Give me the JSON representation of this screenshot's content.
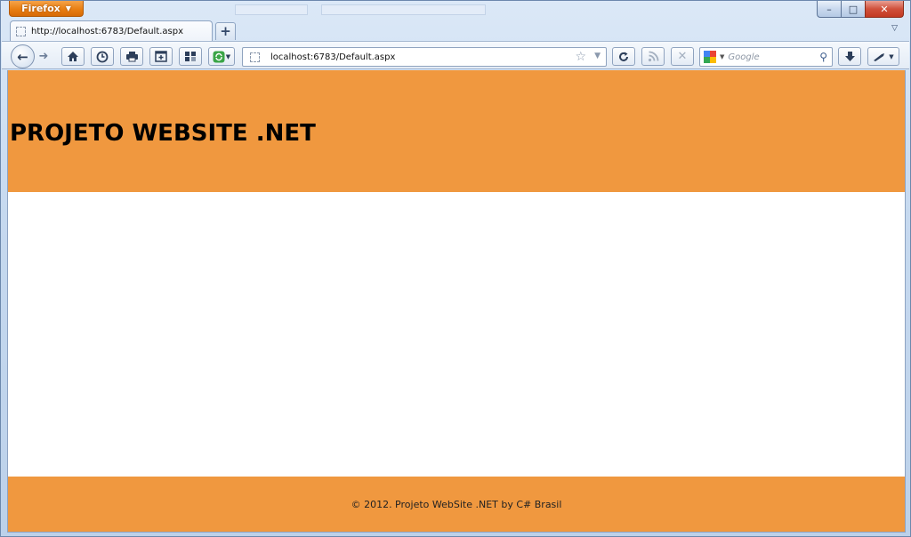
{
  "browser": {
    "menu_button": "Firefox",
    "tab": {
      "title": "http://localhost:6783/Default.aspx"
    },
    "new_tab_label": "+",
    "url": "localhost:6783/Default.aspx",
    "search_placeholder": "Google",
    "window_controls": {
      "minimize": "–",
      "maximize": "□",
      "close": "✕"
    }
  },
  "page": {
    "header_title": "PROJETO WEBSITE .NET",
    "footer_text": "© 2012. Projeto WebSite .NET by C# Brasil"
  },
  "colors": {
    "page_accent": "#F0983F",
    "page_body": "#FFFFFF"
  }
}
